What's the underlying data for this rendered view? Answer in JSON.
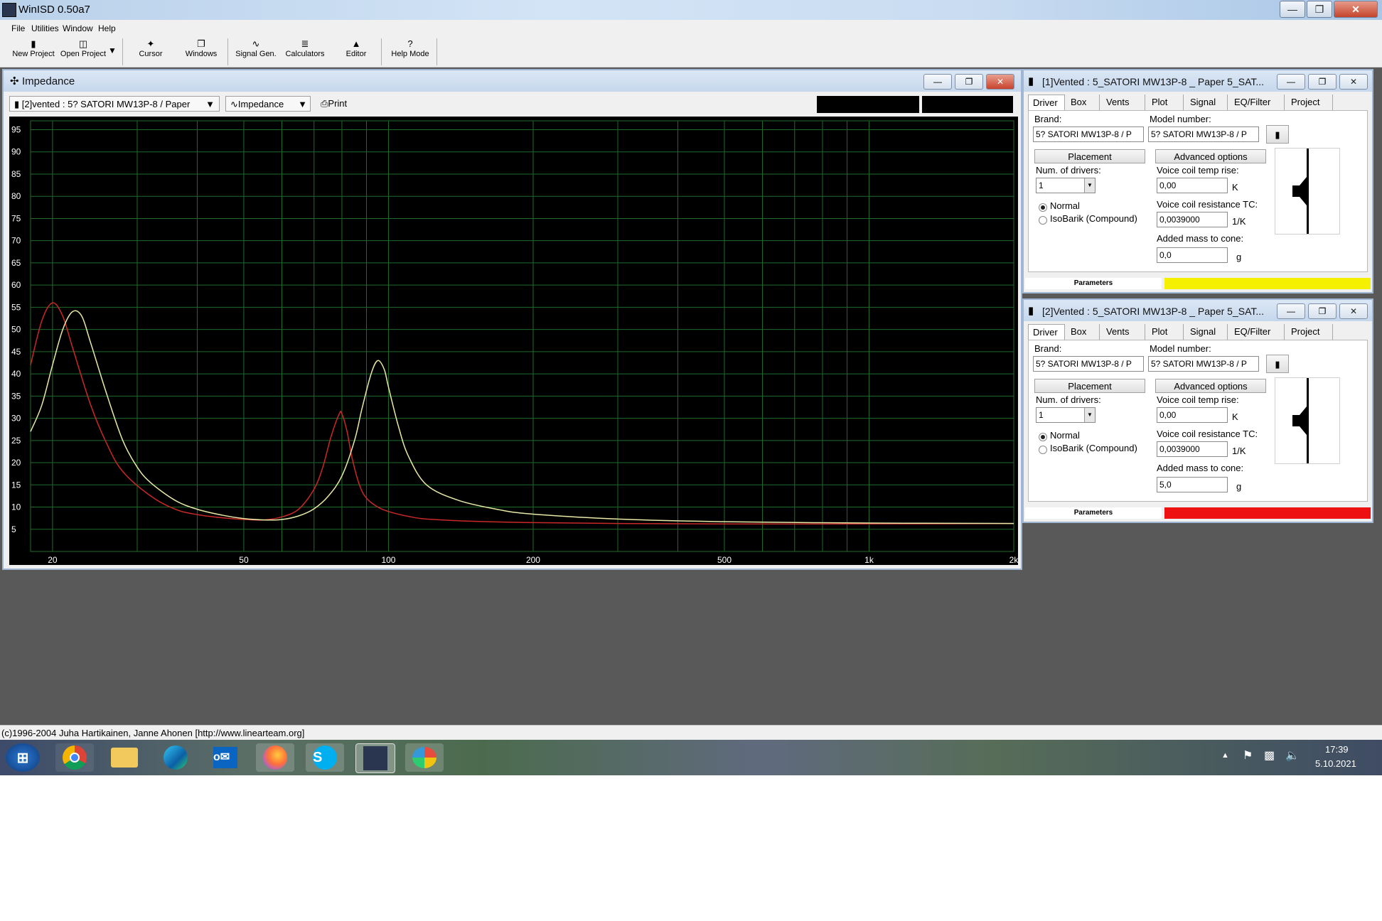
{
  "app": {
    "title": "WinISD 0.50a7"
  },
  "menu": [
    "File",
    "Utilities",
    "Window",
    "Help"
  ],
  "toolbar": [
    {
      "label": "New Project",
      "icon": "new-project-icon"
    },
    {
      "label": "Open Project",
      "icon": "open-folder-icon"
    },
    {
      "label": "Cursor",
      "icon": "cursor-icon"
    },
    {
      "label": "Windows",
      "icon": "windows-icon"
    },
    {
      "label": "Signal Gen.",
      "icon": "sine-icon"
    },
    {
      "label": "Calculators",
      "icon": "calculator-icon"
    },
    {
      "label": "Editor",
      "icon": "speaker-icon"
    },
    {
      "label": "Help Mode",
      "icon": "question-icon"
    }
  ],
  "impedance_window": {
    "title": "Impedance",
    "project_select": "[2]vented : 5? SATORI MW13P-8 / Paper",
    "plot_select": "Impedance",
    "print_label": "Print"
  },
  "chart_data": {
    "type": "line",
    "title": "",
    "xlabel": "",
    "ylabel": "",
    "xscale": "log",
    "xlim": [
      18,
      2000
    ],
    "ylim": [
      0,
      97
    ],
    "x_tick_labels": [
      "20",
      "50",
      "100",
      "200",
      "500",
      "1k",
      "2k"
    ],
    "y_tick_labels": [
      "95",
      "90",
      "85",
      "80",
      "75",
      "70",
      "65",
      "60",
      "55",
      "50",
      "45",
      "40",
      "35",
      "30",
      "25",
      "20",
      "15",
      "10",
      "5"
    ],
    "grid": true,
    "series": [
      {
        "color": "#c82828",
        "x": [
          18,
          19,
          20,
          21,
          22,
          24,
          26,
          28,
          32,
          36,
          40,
          45,
          50,
          55,
          60,
          65,
          70,
          73,
          76,
          79,
          80,
          82,
          84,
          87,
          90,
          95,
          100,
          110,
          120,
          150,
          200,
          300,
          500,
          1000,
          2000
        ],
        "y": [
          42,
          52,
          56,
          53,
          46,
          33,
          24,
          18,
          12.5,
          9.5,
          8.3,
          7.6,
          7.2,
          7.1,
          7.8,
          9.5,
          14,
          19,
          26,
          31,
          31,
          27,
          21,
          15,
          12,
          10,
          9,
          7.9,
          7.3,
          6.8,
          6.5,
          6.3,
          6.2,
          6.2,
          6.3
        ]
      },
      {
        "color": "#e8e8a8",
        "x": [
          18,
          19,
          20,
          21,
          22,
          23,
          24,
          26,
          28,
          30,
          32,
          36,
          40,
          45,
          50,
          55,
          60,
          65,
          70,
          75,
          80,
          85,
          88,
          92,
          95,
          98,
          100,
          105,
          110,
          120,
          140,
          170,
          200,
          300,
          500,
          1000,
          2000
        ],
        "y": [
          27,
          33,
          42,
          50,
          54,
          53,
          47,
          35,
          25,
          19,
          15.5,
          11.5,
          9.5,
          8.2,
          7.4,
          7.1,
          7.2,
          8,
          9.6,
          12.5,
          17,
          25,
          32,
          40,
          43,
          41,
          37,
          28,
          21.5,
          15,
          11.5,
          9.4,
          8.4,
          7.3,
          6.7,
          6.4,
          6.3
        ]
      }
    ]
  },
  "driver_panels": [
    {
      "title": "[1]Vented : 5_SATORI MW13P-8 _ Paper 5_SAT...",
      "tabs": [
        "Driver",
        "Box",
        "Vents",
        "Plot",
        "Signal",
        "EQ/Filter",
        "Project"
      ],
      "brand_label": "Brand:",
      "brand": "5? SATORI MW13P-8 / P",
      "model_label": "Model number:",
      "model": "5? SATORI MW13P-8 / P",
      "placement": "Placement",
      "advanced": "Advanced options",
      "num_drivers_label": "Num. of drivers:",
      "num_drivers": "1",
      "normal": "Normal",
      "isobarik": "IsoBarik (Compound)",
      "vc_temp_label": "Voice coil temp rise:",
      "vc_temp": "0,00",
      "vc_temp_unit": "K",
      "vc_tc_label": "Voice coil resistance TC:",
      "vc_tc": "0,0039000",
      "vc_tc_unit": "1/K",
      "mass_label": "Added mass to cone:",
      "mass": "0,0",
      "mass_unit": "g",
      "params_label": "Parameters",
      "color": "#f5f000"
    },
    {
      "title": "[2]Vented : 5_SATORI MW13P-8 _ Paper 5_SAT...",
      "tabs": [
        "Driver",
        "Box",
        "Vents",
        "Plot",
        "Signal",
        "EQ/Filter",
        "Project"
      ],
      "brand_label": "Brand:",
      "brand": "5? SATORI MW13P-8 / P",
      "model_label": "Model number:",
      "model": "5? SATORI MW13P-8 / P",
      "placement": "Placement",
      "advanced": "Advanced options",
      "num_drivers_label": "Num. of drivers:",
      "num_drivers": "1",
      "normal": "Normal",
      "isobarik": "IsoBarik (Compound)",
      "vc_temp_label": "Voice coil temp rise:",
      "vc_temp": "0,00",
      "vc_temp_unit": "K",
      "vc_tc_label": "Voice coil resistance TC:",
      "vc_tc": "0,0039000",
      "vc_tc_unit": "1/K",
      "mass_label": "Added mass to cone:",
      "mass": "5,0",
      "mass_unit": "g",
      "params_label": "Parameters",
      "color": "#ee1111"
    }
  ],
  "status": "(c)1996-2004 Juha Hartikainen, Janne Ahonen [http://www.linearteam.org]",
  "taskbar": {
    "time": "17:39",
    "date": "5.10.2021"
  }
}
